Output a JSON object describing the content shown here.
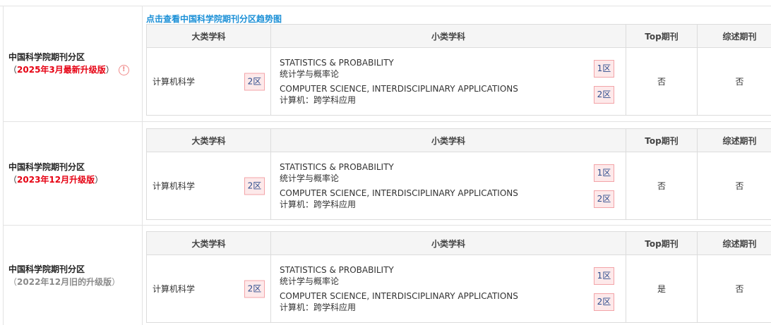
{
  "trend_link": "点击查看中国科学院期刊分区趋势图",
  "headers": {
    "big_subject": "大类学科",
    "small_subject": "小类学科",
    "top_journal": "Top期刊",
    "review_journal": "综述期刊"
  },
  "rows": [
    {
      "title": "中国科学院期刊分区",
      "paren_open": "（",
      "version": "2025年3月最新升级版",
      "paren_close": "）",
      "version_style": "new",
      "has_info_icon": true,
      "big_subject": "计算机科学",
      "big_zone": "2区",
      "subs": [
        {
          "en": "STATISTICS & PROBABILITY",
          "cn": "统计学与概率论",
          "zone": "1区"
        },
        {
          "en": "COMPUTER SCIENCE, INTERDISCIPLINARY APPLICATIONS",
          "cn": "计算机：跨学科应用",
          "zone": "2区"
        }
      ],
      "top": "否",
      "review": "否"
    },
    {
      "title": "中国科学院期刊分区",
      "paren_open": "（",
      "version": "2023年12月升级版",
      "paren_close": "）",
      "version_style": "new",
      "has_info_icon": false,
      "big_subject": "计算机科学",
      "big_zone": "2区",
      "subs": [
        {
          "en": "STATISTICS & PROBABILITY",
          "cn": "统计学与概率论",
          "zone": "1区"
        },
        {
          "en": "COMPUTER SCIENCE, INTERDISCIPLINARY APPLICATIONS",
          "cn": "计算机：跨学科应用",
          "zone": "2区"
        }
      ],
      "top": "否",
      "review": "否"
    },
    {
      "title": "中国科学院期刊分区",
      "paren_open": "（",
      "version": "2022年12月旧的升级版",
      "paren_close": "）",
      "version_style": "old",
      "has_info_icon": false,
      "big_subject": "计算机科学",
      "big_zone": "2区",
      "subs": [
        {
          "en": "STATISTICS & PROBABILITY",
          "cn": "统计学与概率论",
          "zone": "1区"
        },
        {
          "en": "COMPUTER SCIENCE, INTERDISCIPLINARY APPLICATIONS",
          "cn": "计算机：跨学科应用",
          "zone": "2区"
        }
      ],
      "top": "是",
      "review": "否"
    }
  ],
  "colors": {
    "version_new": "#e60012",
    "version_old": "#8a8a8a",
    "link": "#1a8fd6",
    "badge_bg": "#fde9ea",
    "badge_border": "#f3a4a8"
  },
  "icons": {
    "info": "info-circle-icon"
  }
}
